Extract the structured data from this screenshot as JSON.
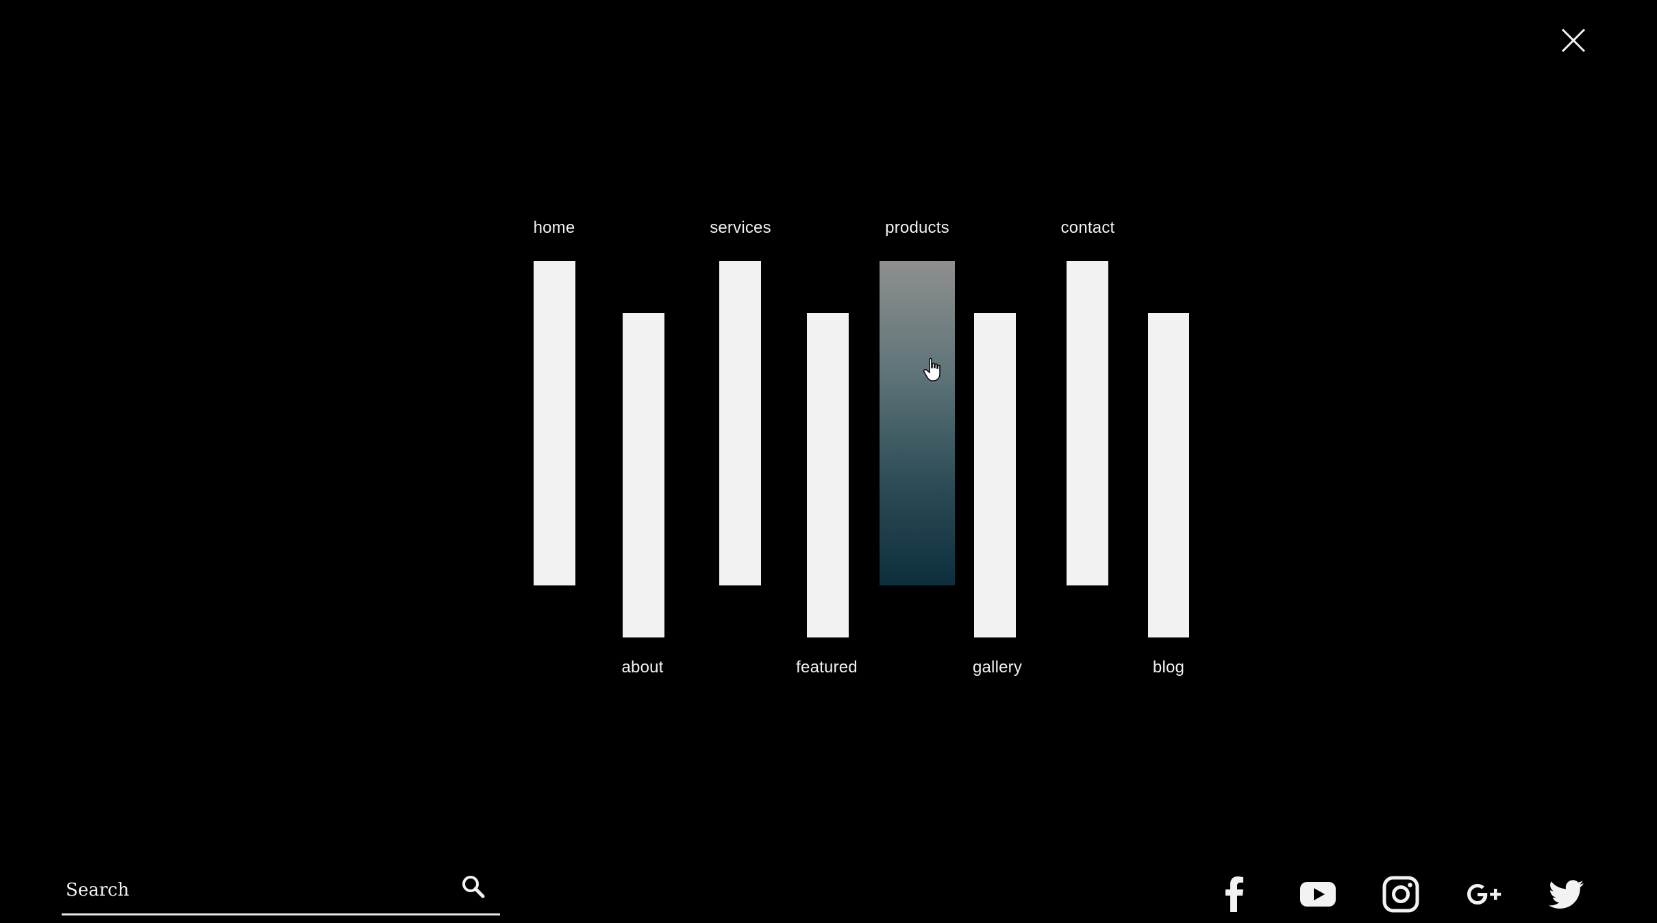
{
  "menu": {
    "close_icon": "close-icon",
    "items": [
      {
        "label": "home"
      },
      {
        "label": "about"
      },
      {
        "label": "services"
      },
      {
        "label": "featured"
      },
      {
        "label": "products",
        "active": true
      },
      {
        "label": "gallery"
      },
      {
        "label": "contact"
      },
      {
        "label": "blog"
      }
    ]
  },
  "search": {
    "placeholder": "Search",
    "icon": "search-icon"
  },
  "social": {
    "icons": [
      "facebook-icon",
      "youtube-icon",
      "instagram-icon",
      "google-plus-icon",
      "twitter-icon"
    ]
  },
  "colors": {
    "background": "#000000",
    "foreground": "#f2f2f2",
    "active_gradient_top": "#8f8f8f",
    "active_gradient_bottom": "#0d2e3c"
  }
}
